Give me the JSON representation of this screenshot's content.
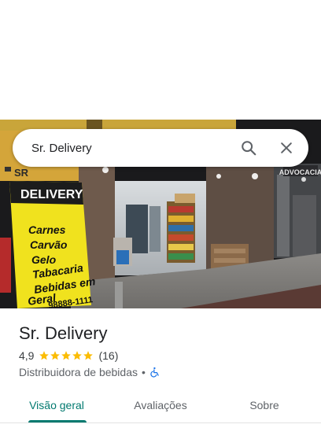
{
  "search": {
    "query": "Sr. Delivery"
  },
  "photo": {
    "sign_top": "SR",
    "sign_title": "DELIVERY",
    "sign_items": [
      "Carnes",
      "Carvão",
      "Gelo",
      "Tabacaria",
      "Bebidas em",
      "Geral"
    ],
    "sign_phone": "98888-1111",
    "neighbor_sign": "ADVOCACIA"
  },
  "place": {
    "name": "Sr. Delivery",
    "rating": "4,9",
    "rating_value": 4.9,
    "reviews": "(16)",
    "category": "Distribuidora de bebidas",
    "separator": "•"
  },
  "tabs": [
    {
      "label": "Visão geral",
      "active": true
    },
    {
      "label": "Avaliações",
      "active": false
    },
    {
      "label": "Sobre",
      "active": false
    }
  ],
  "colors": {
    "accent": "#01796f",
    "star": "#fbbc04",
    "accessibility": "#1a73e8"
  }
}
